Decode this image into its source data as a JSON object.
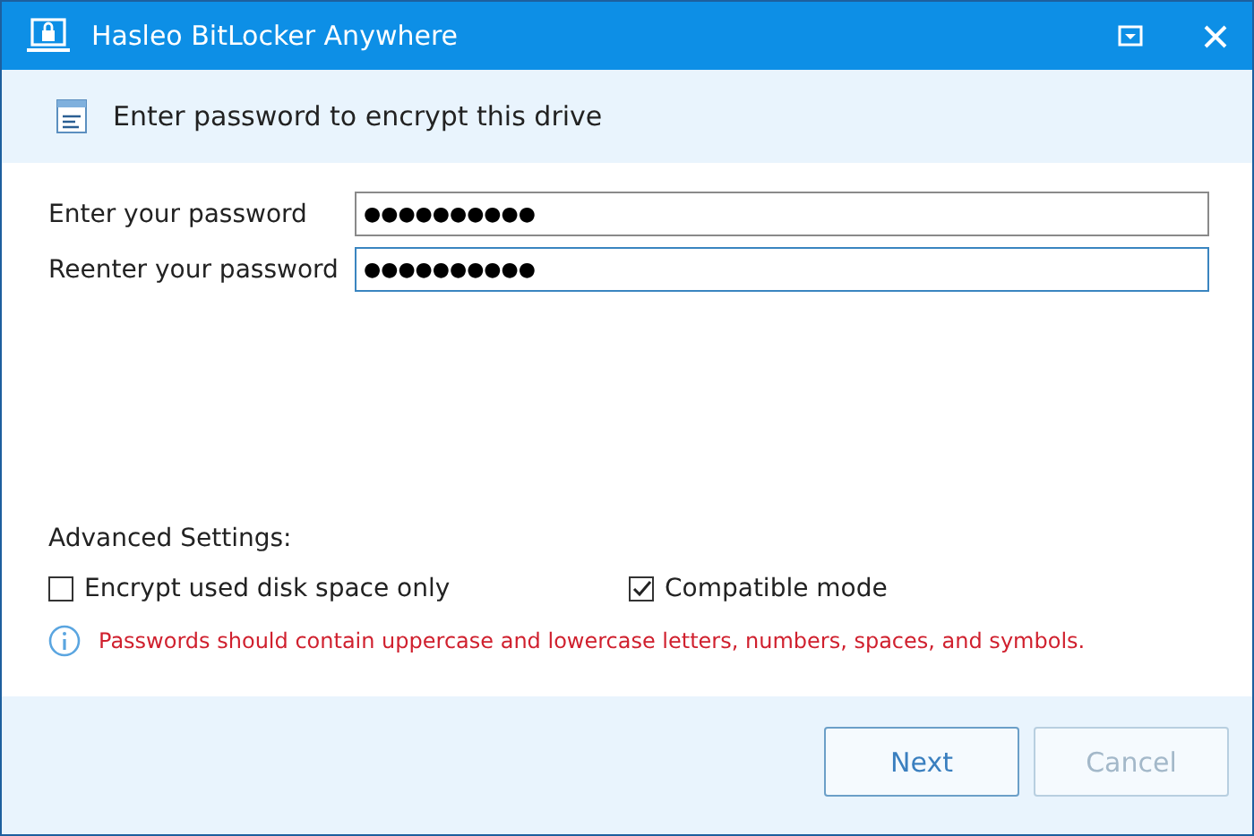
{
  "window": {
    "title": "Hasleo BitLocker Anywhere"
  },
  "header": {
    "text": "Enter password to encrypt this drive"
  },
  "fields": [
    {
      "label": "Enter your password",
      "value": "●●●●●●●●●●",
      "focused": false
    },
    {
      "label": "Reenter your password",
      "value": "●●●●●●●●●●",
      "focused": true
    }
  ],
  "advanced": {
    "title": "Advanced Settings:",
    "options": [
      {
        "label": "Encrypt used disk space only",
        "checked": false
      },
      {
        "label": "Compatible mode",
        "checked": true
      }
    ]
  },
  "hint": "Passwords should contain uppercase and lowercase letters, numbers, spaces, and symbols.",
  "buttons": [
    {
      "label": "Next",
      "disabled": false
    },
    {
      "label": "Cancel",
      "disabled": true
    }
  ]
}
